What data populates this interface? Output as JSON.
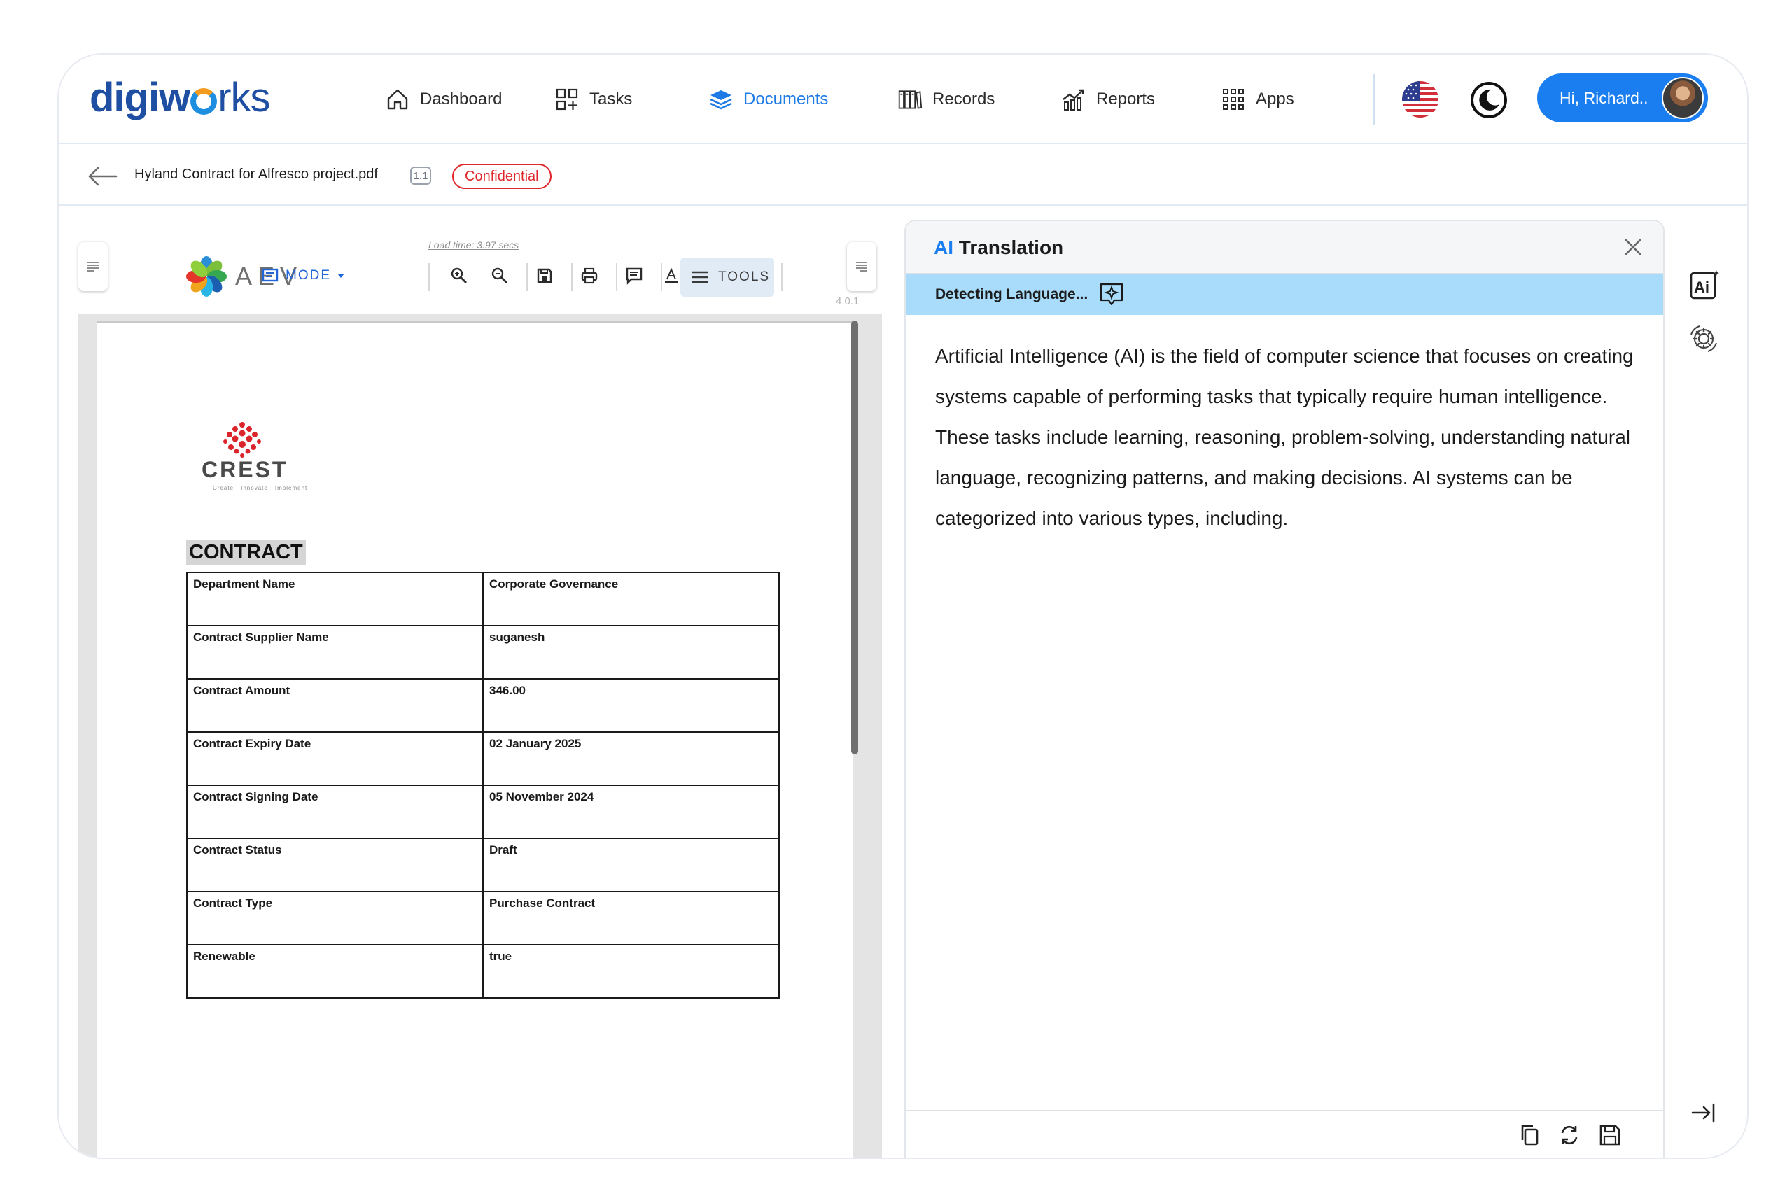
{
  "app": {
    "logo_main": "digiw",
    "logo_tail": "rks"
  },
  "nav": {
    "items": [
      {
        "label": "Dashboard",
        "icon": "home-icon"
      },
      {
        "label": "Tasks",
        "icon": "tasks-icon"
      },
      {
        "label": "Documents",
        "icon": "documents-icon",
        "active": true
      },
      {
        "label": "Records",
        "icon": "records-icon"
      },
      {
        "label": "Reports",
        "icon": "reports-icon"
      },
      {
        "label": "Apps",
        "icon": "apps-grid-icon"
      }
    ],
    "user_greeting": "Hi, Richard..",
    "language_icon": "us-flag-icon",
    "theme_icon": "moon-icon"
  },
  "file": {
    "name": "Hyland Contract for Alfresco project.pdf",
    "version": "1.1",
    "classification": "Confidential"
  },
  "viewer": {
    "load_time": "Load time: 3.97 secs",
    "brand": "AEV",
    "mode_label": "MODE",
    "tools_label": "TOOLS",
    "version": "4.0.1",
    "document": {
      "company_logo_text": "CREST",
      "company_tagline": "Create · Innovate · Implement",
      "title": "CONTRACT",
      "rows": [
        {
          "key": "Department Name",
          "value": "Corporate Governance"
        },
        {
          "key": "Contract Supplier Name",
          "value": "suganesh"
        },
        {
          "key": "Contract Amount",
          "value": "346.00"
        },
        {
          "key": "Contract Expiry Date",
          "value": "02 January 2025"
        },
        {
          "key": "Contract Signing Date",
          "value": "05 November 2024"
        },
        {
          "key": "Contract Status",
          "value": "Draft"
        },
        {
          "key": "Contract Type",
          "value": "Purchase Contract"
        },
        {
          "key": "Renewable",
          "value": "true"
        }
      ]
    }
  },
  "ai_panel": {
    "title_prefix": "AI",
    "title": "Translation",
    "status": "Detecting Language...",
    "body": "Artificial Intelligence (AI) is the field of computer science  that focuses on creating systems capable of performing tasks that typically require human intelligence. These tasks include learning, reasoning, problem-solving, understanding natural language, recognizing patterns, and making decisions. AI systems can be categorized into various types, including.",
    "footer_icons": [
      "copy-icon",
      "refresh-icon",
      "save-icon"
    ]
  },
  "colors": {
    "accent": "#1a7ef0",
    "brand_dark": "#1e4fa3",
    "confidential": "#e0262b",
    "detect_bar": "#a9dcfb"
  }
}
